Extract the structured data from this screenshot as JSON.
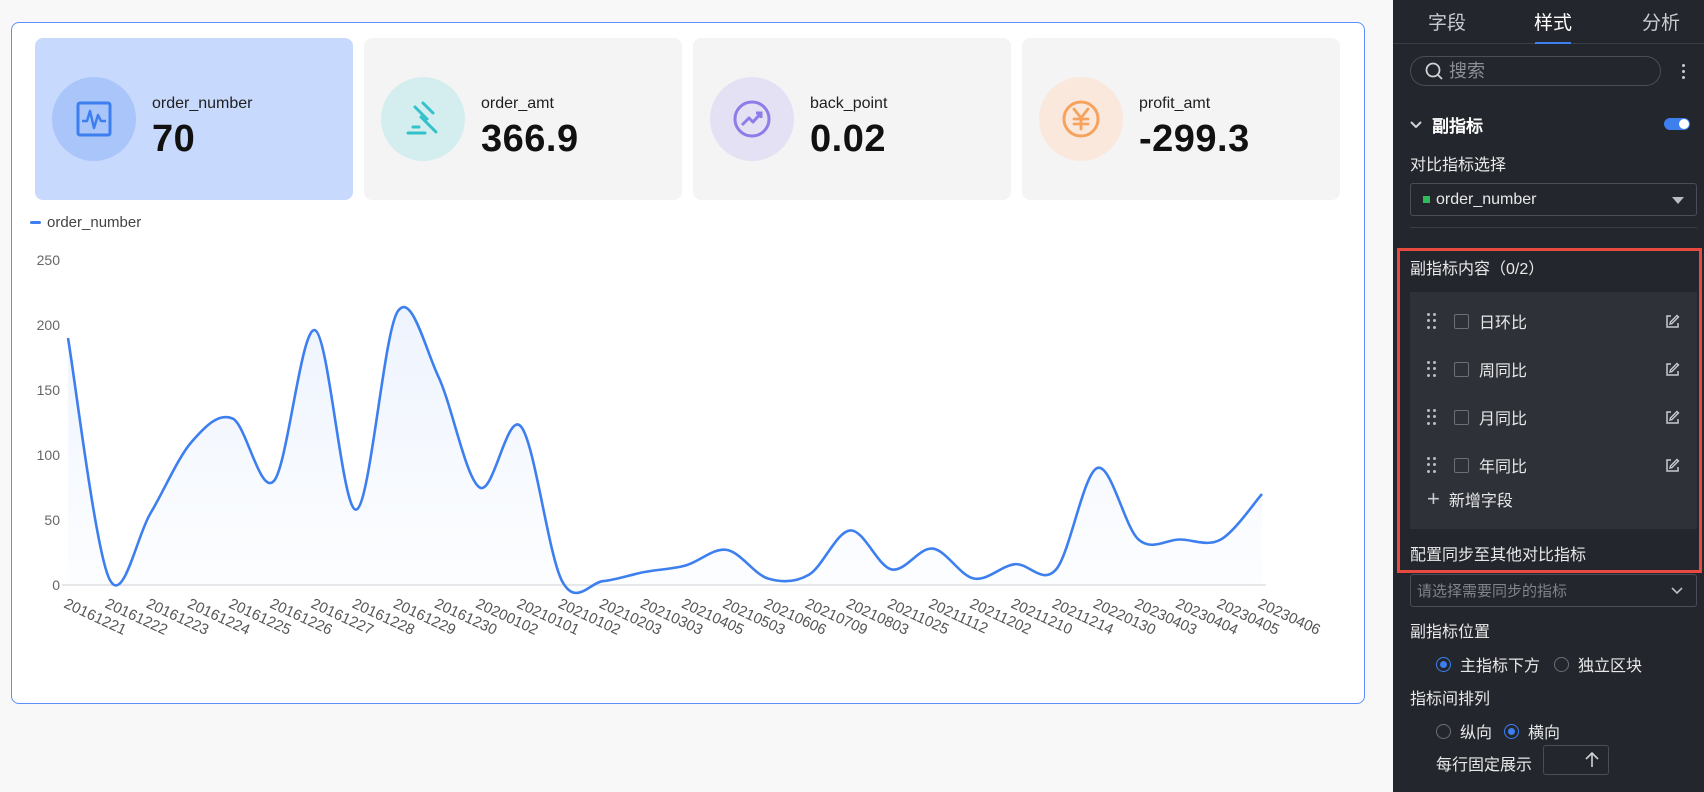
{
  "kpis": [
    {
      "name": "order_number",
      "value": "70",
      "icon": "pulse-icon",
      "color": "#3d7fef",
      "bg": "#a9c5fa"
    },
    {
      "name": "order_amt",
      "value": "366.9",
      "icon": "gavel-icon",
      "color": "#33c2c9",
      "bg": "#d4eeef"
    },
    {
      "name": "back_point",
      "value": "0.02",
      "icon": "trend-up-icon",
      "color": "#8e7ce8",
      "bg": "#e4e1f5"
    },
    {
      "name": "profit_amt",
      "value": "-299.3",
      "icon": "yen-icon",
      "color": "#f5a35f",
      "bg": "#fbe8dc"
    }
  ],
  "chart_data": {
    "type": "line",
    "title": "",
    "xlabel": "",
    "ylabel": "",
    "ylim": [
      0,
      250
    ],
    "y_ticks": [
      0,
      50,
      100,
      150,
      200,
      250
    ],
    "grid": false,
    "legend": "top-left",
    "series": [
      {
        "name": "order_number",
        "color": "#3d7fef",
        "values": [
          190,
          5,
          55,
          110,
          128,
          80,
          196,
          58,
          210,
          160,
          75,
          122,
          3,
          3,
          10,
          15,
          27,
          5,
          8,
          42,
          12,
          28,
          5,
          16,
          12,
          90,
          35,
          35,
          35,
          70
        ]
      }
    ],
    "x": [
      "20161221",
      "20161222",
      "20161223",
      "20161224",
      "20161225",
      "20161226",
      "20161227",
      "20161228",
      "20161229",
      "20161230",
      "20200102",
      "20210101",
      "20210102",
      "20210203",
      "20210303",
      "20210405",
      "20210503",
      "20210606",
      "20210709",
      "20210803",
      "20211025",
      "20211112",
      "20211202",
      "20211210",
      "20211214",
      "20220130",
      "20230403",
      "20230404",
      "20230405",
      "20230406"
    ]
  },
  "panel": {
    "tabs": [
      "字段",
      "样式",
      "分析"
    ],
    "search_placeholder": "搜索",
    "section_title": "副指标",
    "compare_label": "对比指标选择",
    "compare_value": "order_number",
    "content_label": "副指标内容（0/2）",
    "items": [
      "日环比",
      "周同比",
      "月同比",
      "年同比"
    ],
    "add_field": "新增字段",
    "sync_label": "配置同步至其他对比指标",
    "sync_placeholder": "请选择需要同步的指标",
    "position_label": "副指标位置",
    "position_options": [
      "主指标下方",
      "独立区块"
    ],
    "arrange_label": "指标间排列",
    "arrange_options": [
      "纵向",
      "横向"
    ],
    "per_row_label": "每行固定展示"
  }
}
